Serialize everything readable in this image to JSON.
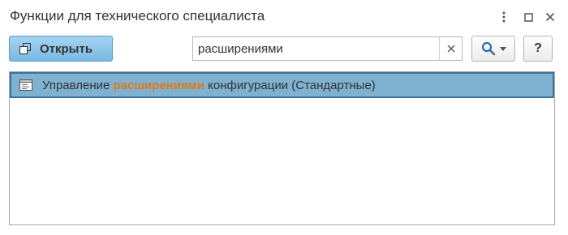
{
  "window": {
    "title": "Функции для технического специалиста"
  },
  "toolbar": {
    "open_label": "Открыть",
    "help_label": "?",
    "search": {
      "value": "расширениями",
      "clear_glyph": "×"
    }
  },
  "list": {
    "rows": [
      {
        "prefix": "Управление ",
        "highlight": "расширениями",
        "suffix": " конфигурации (Стандартные)",
        "icon": "document-icon",
        "selected": true
      }
    ]
  },
  "colors": {
    "open_button": "#7ab9e3",
    "selected_row": "#7fb1d0",
    "selected_border": "#3d72a0",
    "highlight_text": "#e07b1a"
  }
}
